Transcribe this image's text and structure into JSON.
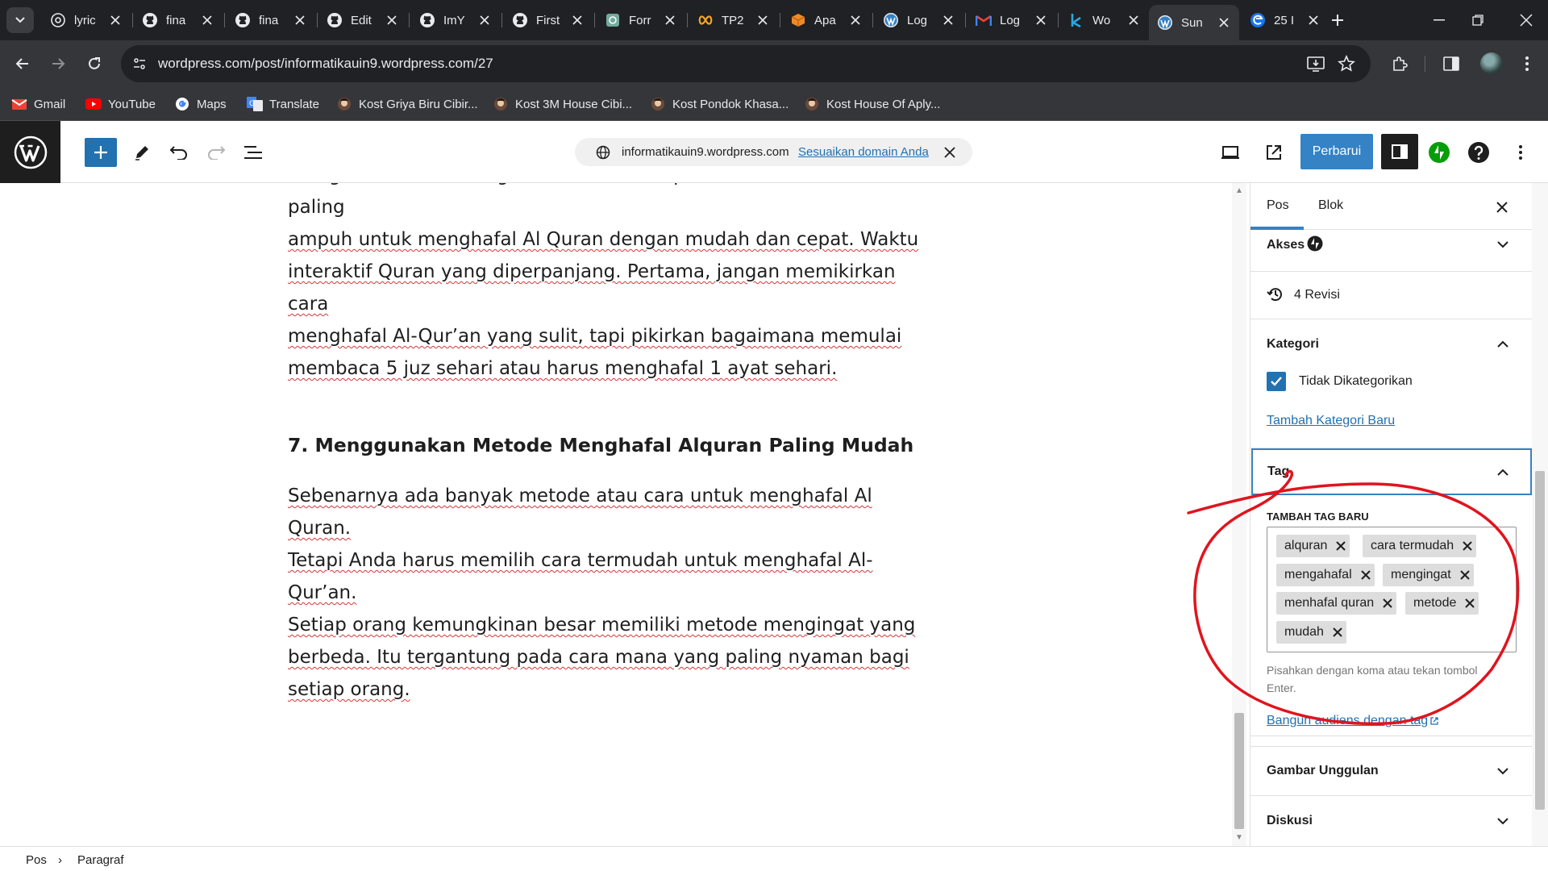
{
  "browser": {
    "tabs": [
      {
        "title": "lyric",
        "icon": "chrome-icon"
      },
      {
        "title": "fina",
        "icon": "github-icon"
      },
      {
        "title": "fina",
        "icon": "github-icon"
      },
      {
        "title": "Edit",
        "icon": "github-icon"
      },
      {
        "title": "ImY",
        "icon": "github-icon"
      },
      {
        "title": "First",
        "icon": "github-icon"
      },
      {
        "title": "Forr",
        "icon": "chatgpt-icon"
      },
      {
        "title": "TP2",
        "icon": "infinity-icon"
      },
      {
        "title": "Apa",
        "icon": "cube-icon"
      },
      {
        "title": "Log",
        "icon": "wordpress-icon"
      },
      {
        "title": "Log",
        "icon": "gmail-icon"
      },
      {
        "title": "Wo",
        "icon": "k-icon"
      },
      {
        "title": "Sun",
        "icon": "wordpress-icon",
        "active": true
      },
      {
        "title": "25 I",
        "icon": "edge-icon"
      }
    ],
    "url": "wordpress.com/post/informatikauin9.wordpress.com/27",
    "bookmarks": [
      {
        "label": "Gmail",
        "icon": "gmail-icon"
      },
      {
        "label": "YouTube",
        "icon": "youtube-icon"
      },
      {
        "label": "Maps",
        "icon": "google-icon"
      },
      {
        "label": "Translate",
        "icon": "translate-icon"
      },
      {
        "label": "Kost Griya Biru Cibir...",
        "icon": "avatar-icon"
      },
      {
        "label": "Kost 3M House Cibi...",
        "icon": "avatar-icon"
      },
      {
        "label": "Kost Pondok Khasa...",
        "icon": "avatar-icon"
      },
      {
        "label": "Kost House Of Aply...",
        "icon": "avatar-icon"
      }
    ]
  },
  "editor": {
    "domain": "informatikauin9.wordpress.com",
    "domain_link": "Sesuaikan domain Anda",
    "update_label": "Perbarui",
    "accent": "#3582c4"
  },
  "post": {
    "para1": {
      "partial_line": "menghafalkan diri dengan Al Quran merupakan salah satu cara paling",
      "line2a": "ampuh untuk menghafal Al Quran dengan mudah dan cepat. Waktu",
      "line3": "interaktif Quran yang diperpanjang. Pertama, jangan memikirkan cara",
      "line4": "menghafal Al-Qur’an yang sulit, tapi pikirkan bagaimana memulai",
      "line5": "membaca 5 juz sehari atau harus menghafal 1 ayat sehari."
    },
    "heading": "7. Menggunakan Metode Menghafal Alquran Paling Mudah",
    "para2": {
      "line1": "Sebenarnya ada banyak metode atau cara untuk menghafal Al Quran.",
      "line2": "Tetapi Anda harus memilih cara termudah untuk menghafal Al-Qur’an.",
      "line3": "Setiap orang kemungkinan besar memiliki metode mengingat yang",
      "line4": "berbeda. Itu tergantung pada cara mana yang paling nyaman bagi",
      "line5": "setiap orang."
    }
  },
  "sidebar": {
    "tab_post": "Pos",
    "tab_block": "Blok",
    "access_label": "Akses",
    "revisions": "4 Revisi",
    "category_title": "Kategori",
    "category_item": "Tidak Dikategorikan",
    "category_add": "Tambah Kategori Baru",
    "tag_title": "Tag",
    "tag_add_label": "TAMBAH TAG BARU",
    "tags": [
      "alquran",
      "cara termudah",
      "mengahafal",
      "mengingat",
      "menhafal quran",
      "metode",
      "mudah"
    ],
    "tag_help": "Pisahkan dengan koma atau tekan tombol Enter.",
    "tag_link": "Bangun audiens dengan tag",
    "featured_title": "Gambar Unggulan",
    "discussion_title": "Diskusi"
  },
  "footer": {
    "crumb1": "Pos",
    "crumb2": "Paragraf"
  },
  "annotation_color": "#e0141e"
}
